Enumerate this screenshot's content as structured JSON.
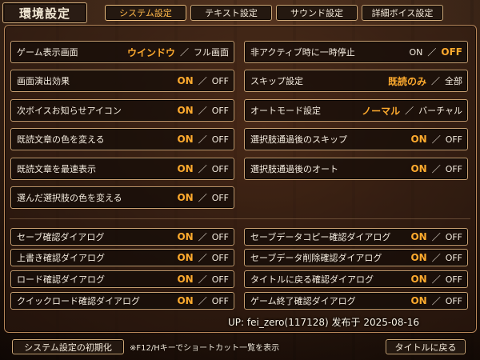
{
  "window_title": "環境設定",
  "tabs": [
    {
      "label": "システム設定",
      "active": true
    },
    {
      "label": "テキスト設定",
      "active": false
    },
    {
      "label": "サウンド設定",
      "active": false
    },
    {
      "label": "詳細ボイス設定",
      "active": false
    }
  ],
  "options": [
    {
      "label": "ゲーム表示画面",
      "values": [
        "ウインドウ",
        "フル画面"
      ],
      "selected": 0
    },
    {
      "label": "非アクティブ時に一時停止",
      "values": [
        "ON",
        "OFF"
      ],
      "selected": 1
    },
    {
      "label": "画面演出効果",
      "values": [
        "ON",
        "OFF"
      ],
      "selected": 0
    },
    {
      "label": "スキップ設定",
      "values": [
        "既読のみ",
        "全部"
      ],
      "selected": 0
    },
    {
      "label": "次ボイスお知らせアイコン",
      "values": [
        "ON",
        "OFF"
      ],
      "selected": 0
    },
    {
      "label": "オートモード設定",
      "values": [
        "ノーマル",
        "バーチャル"
      ],
      "selected": 0
    },
    {
      "label": "既読文章の色を変える",
      "values": [
        "ON",
        "OFF"
      ],
      "selected": 0
    },
    {
      "label": "選択肢通過後のスキップ",
      "values": [
        "ON",
        "OFF"
      ],
      "selected": 0
    },
    {
      "label": "既読文章を最速表示",
      "values": [
        "ON",
        "OFF"
      ],
      "selected": 0
    },
    {
      "label": "選択肢通過後のオート",
      "values": [
        "ON",
        "OFF"
      ],
      "selected": 0
    },
    {
      "label": "選んだ選択肢の色を変える",
      "values": [
        "ON",
        "OFF"
      ],
      "selected": 0
    },
    {
      "label": "セーブ確認ダイアログ",
      "values": [
        "ON",
        "OFF"
      ],
      "selected": 0
    },
    {
      "label": "セーブデータコピー確認ダイアログ",
      "values": [
        "ON",
        "OFF"
      ],
      "selected": 0
    },
    {
      "label": "上書き確認ダイアログ",
      "values": [
        "ON",
        "OFF"
      ],
      "selected": 0
    },
    {
      "label": "セーブデータ削除確認ダイアログ",
      "values": [
        "ON",
        "OFF"
      ],
      "selected": 0
    },
    {
      "label": "ロード確認ダイアログ",
      "values": [
        "ON",
        "OFF"
      ],
      "selected": 0
    },
    {
      "label": "タイトルに戻る確認ダイアログ",
      "values": [
        "ON",
        "OFF"
      ],
      "selected": 0
    },
    {
      "label": "クイックロード確認ダイアログ",
      "values": [
        "ON",
        "OFF"
      ],
      "selected": 0
    },
    {
      "label": "ゲーム終了確認ダイアログ",
      "values": [
        "ON",
        "OFF"
      ],
      "selected": 0
    }
  ],
  "value_separator": "／",
  "credit": "UP: fei_zero(117128) 发布于 2025-08-16",
  "footer": {
    "reset_label": "システム設定の初期化",
    "hint": "※F12/Hキーでショートカット一覧を表示",
    "title_label": "タイトルに戻る"
  },
  "colors": {
    "accent": "#ffab2e",
    "border": "#c8a072",
    "panel": "#241810"
  }
}
